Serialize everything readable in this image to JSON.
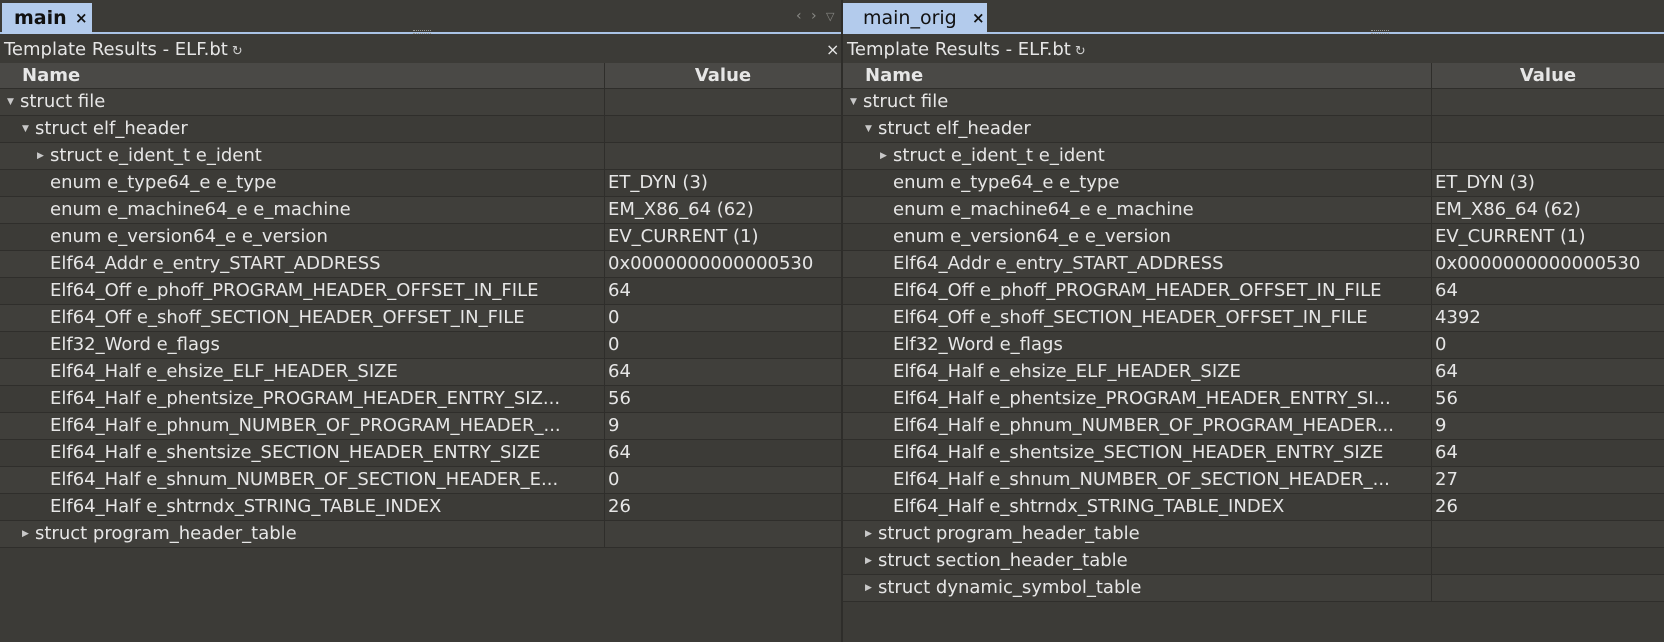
{
  "left": {
    "tab_label": "main",
    "tab_close": "×",
    "nav": [
      "‹",
      "›",
      "▽"
    ],
    "panel_title": "Template Results - ELF.bt",
    "refresh_glyph": "↻",
    "panel_close": "×",
    "columns": {
      "name": "Name",
      "value": "Value"
    },
    "rows": [
      {
        "name": "struct file",
        "value": "",
        "indent": 0,
        "toggle": "expanded"
      },
      {
        "name": "struct elf_header",
        "value": "",
        "indent": 1,
        "toggle": "expanded"
      },
      {
        "name": "struct e_ident_t e_ident",
        "value": "",
        "indent": 2,
        "toggle": "collapsed"
      },
      {
        "name": "enum e_type64_e e_type",
        "value": "ET_DYN (3)",
        "indent": 2,
        "toggle": "none"
      },
      {
        "name": "enum e_machine64_e e_machine",
        "value": "EM_X86_64 (62)",
        "indent": 2,
        "toggle": "none"
      },
      {
        "name": "enum e_version64_e e_version",
        "value": "EV_CURRENT (1)",
        "indent": 2,
        "toggle": "none"
      },
      {
        "name": "Elf64_Addr e_entry_START_ADDRESS",
        "value": "0x0000000000000530",
        "indent": 2,
        "toggle": "none"
      },
      {
        "name": "Elf64_Off e_phoff_PROGRAM_HEADER_OFFSET_IN_FILE",
        "value": "64",
        "indent": 2,
        "toggle": "none"
      },
      {
        "name": "Elf64_Off e_shoff_SECTION_HEADER_OFFSET_IN_FILE",
        "value": "0",
        "indent": 2,
        "toggle": "none"
      },
      {
        "name": "Elf32_Word e_flags",
        "value": "0",
        "indent": 2,
        "toggle": "none"
      },
      {
        "name": "Elf64_Half e_ehsize_ELF_HEADER_SIZE",
        "value": "64",
        "indent": 2,
        "toggle": "none"
      },
      {
        "name": "Elf64_Half e_phentsize_PROGRAM_HEADER_ENTRY_SIZ...",
        "value": "56",
        "indent": 2,
        "toggle": "none"
      },
      {
        "name": "Elf64_Half e_phnum_NUMBER_OF_PROGRAM_HEADER_...",
        "value": "9",
        "indent": 2,
        "toggle": "none"
      },
      {
        "name": "Elf64_Half e_shentsize_SECTION_HEADER_ENTRY_SIZE",
        "value": "64",
        "indent": 2,
        "toggle": "none"
      },
      {
        "name": "Elf64_Half e_shnum_NUMBER_OF_SECTION_HEADER_E...",
        "value": "0",
        "indent": 2,
        "toggle": "none"
      },
      {
        "name": "Elf64_Half e_shtrndx_STRING_TABLE_INDEX",
        "value": "26",
        "indent": 2,
        "toggle": "none"
      },
      {
        "name": "struct program_header_table",
        "value": "",
        "indent": 1,
        "toggle": "collapsed"
      }
    ]
  },
  "right": {
    "tab_label": "main_orig",
    "tab_close": "×",
    "panel_title": "Template Results - ELF.bt",
    "refresh_glyph": "↻",
    "columns": {
      "name": "Name",
      "value": "Value"
    },
    "rows": [
      {
        "name": "struct file",
        "value": "",
        "indent": 0,
        "toggle": "expanded"
      },
      {
        "name": "struct elf_header",
        "value": "",
        "indent": 1,
        "toggle": "expanded"
      },
      {
        "name": "struct e_ident_t e_ident",
        "value": "",
        "indent": 2,
        "toggle": "collapsed"
      },
      {
        "name": "enum e_type64_e e_type",
        "value": "ET_DYN (3)",
        "indent": 2,
        "toggle": "none"
      },
      {
        "name": "enum e_machine64_e e_machine",
        "value": "EM_X86_64 (62)",
        "indent": 2,
        "toggle": "none"
      },
      {
        "name": "enum e_version64_e e_version",
        "value": "EV_CURRENT (1)",
        "indent": 2,
        "toggle": "none"
      },
      {
        "name": "Elf64_Addr e_entry_START_ADDRESS",
        "value": "0x0000000000000530",
        "indent": 2,
        "toggle": "none"
      },
      {
        "name": "Elf64_Off e_phoff_PROGRAM_HEADER_OFFSET_IN_FILE",
        "value": "64",
        "indent": 2,
        "toggle": "none"
      },
      {
        "name": "Elf64_Off e_shoff_SECTION_HEADER_OFFSET_IN_FILE",
        "value": "4392",
        "indent": 2,
        "toggle": "none"
      },
      {
        "name": "Elf32_Word e_flags",
        "value": "0",
        "indent": 2,
        "toggle": "none"
      },
      {
        "name": "Elf64_Half e_ehsize_ELF_HEADER_SIZE",
        "value": "64",
        "indent": 2,
        "toggle": "none"
      },
      {
        "name": "Elf64_Half e_phentsize_PROGRAM_HEADER_ENTRY_SI...",
        "value": "56",
        "indent": 2,
        "toggle": "none"
      },
      {
        "name": "Elf64_Half e_phnum_NUMBER_OF_PROGRAM_HEADER...",
        "value": "9",
        "indent": 2,
        "toggle": "none"
      },
      {
        "name": "Elf64_Half e_shentsize_SECTION_HEADER_ENTRY_SIZE",
        "value": "64",
        "indent": 2,
        "toggle": "none"
      },
      {
        "name": "Elf64_Half e_shnum_NUMBER_OF_SECTION_HEADER_...",
        "value": "27",
        "indent": 2,
        "toggle": "none"
      },
      {
        "name": "Elf64_Half e_shtrndx_STRING_TABLE_INDEX",
        "value": "26",
        "indent": 2,
        "toggle": "none"
      },
      {
        "name": "struct program_header_table",
        "value": "",
        "indent": 1,
        "toggle": "collapsed"
      },
      {
        "name": "struct section_header_table",
        "value": "",
        "indent": 1,
        "toggle": "collapsed"
      },
      {
        "name": "struct dynamic_symbol_table",
        "value": "",
        "indent": 1,
        "toggle": "collapsed"
      }
    ]
  }
}
